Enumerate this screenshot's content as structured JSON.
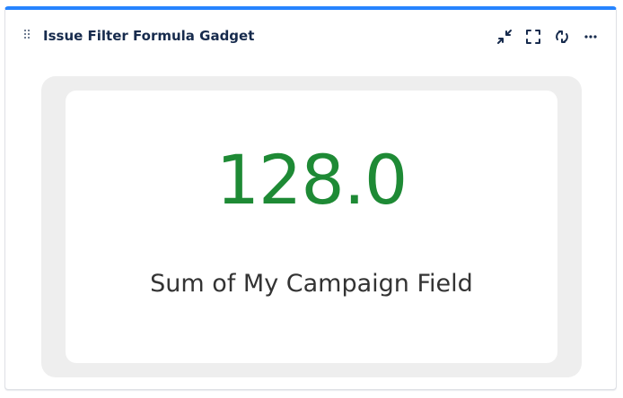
{
  "gadget": {
    "title": "Issue Filter Formula Gadget",
    "actions": [
      {
        "name": "minimize",
        "icon": "collapse-arrows-icon"
      },
      {
        "name": "maximize",
        "icon": "fullscreen-icon"
      },
      {
        "name": "refresh",
        "icon": "refresh-icon"
      },
      {
        "name": "more",
        "icon": "more-dots-icon"
      }
    ]
  },
  "metric": {
    "value": "128.0",
    "label": "Sum of My Campaign Field",
    "value_color": "#1e8a35"
  },
  "colors": {
    "accent": "#2684ff",
    "card_background": "#eeeeee"
  }
}
